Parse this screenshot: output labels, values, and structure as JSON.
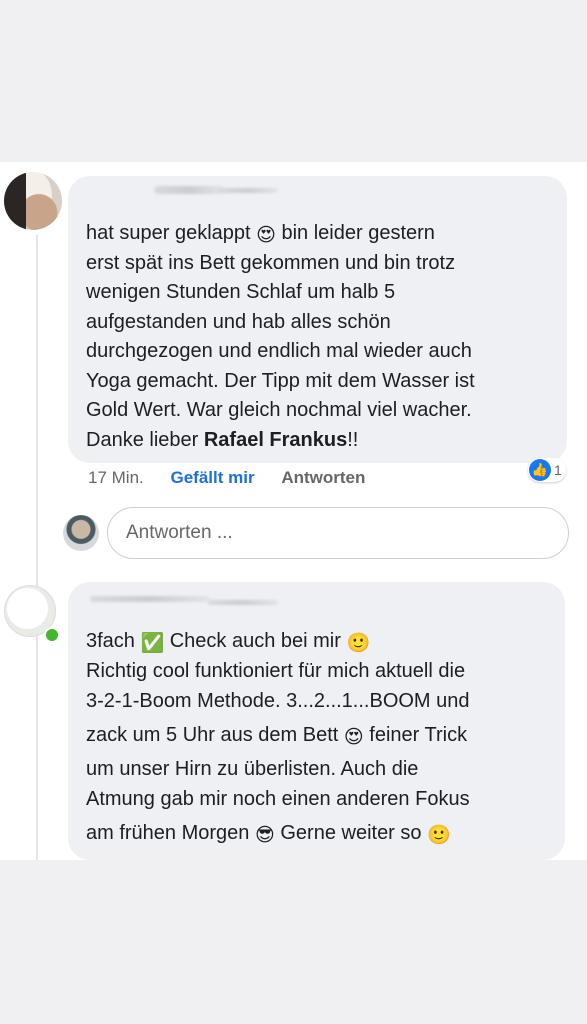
{
  "comment1": {
    "lines": [
      {
        "pre": "hat super geklappt ",
        "emoji": "😍",
        "post": " bin leider gestern"
      },
      {
        "pre": "erst spät ins Bett gekommen und bin trotz"
      },
      {
        "pre": "wenigen Stunden Schlaf um halb 5"
      },
      {
        "pre": "aufgestanden und hab alles schön"
      },
      {
        "pre": "durchgezogen und endlich mal wieder auch"
      },
      {
        "pre": "Yoga gemacht. Der Tipp mit dem Wasser ist"
      },
      {
        "pre": "Gold Wert. War gleich nochmal viel wacher."
      },
      {
        "pre": "Danke lieber ",
        "bold": "Rafael Frankus",
        "post": "!!"
      }
    ],
    "time": "17 Min.",
    "like_label": "Gefällt mir",
    "reply_label": "Antworten",
    "reaction_icon": "👍",
    "reaction_count": "1"
  },
  "reply_input": {
    "placeholder": "Antworten ..."
  },
  "comment2": {
    "lines": [
      {
        "pre": "3fach ",
        "emoji": "✅",
        "post": " Check auch bei mir ",
        "emoji2": "🙂"
      },
      {
        "pre": "Richtig cool funktioniert für mich aktuell die"
      },
      {
        "pre": "3-2-1-Boom Methode. 3...2...1...BOOM und"
      },
      {
        "pre": "zack um 5 Uhr aus dem Bett ",
        "emoji": "😍",
        "post": " feiner Trick"
      },
      {
        "pre": "um unser Hirn zu überlisten. Auch die"
      },
      {
        "pre": "Atmung gab mir noch einen anderen Fokus"
      },
      {
        "pre": "am frühen Morgen ",
        "emoji": "😎",
        "post": " Gerne weiter so ",
        "emoji2": "🙂"
      }
    ]
  }
}
